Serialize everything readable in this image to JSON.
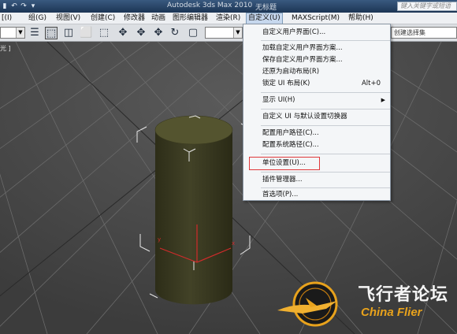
{
  "titlebar": {
    "quick_access": [
      "▮",
      "↶",
      "↷",
      "▾"
    ],
    "app_title": "Autodesk 3ds Max  2010",
    "doc_name": "无标题",
    "search_placeholder": "键入关键字或短语"
  },
  "menubar": {
    "items": [
      {
        "label": "[(I)"
      },
      {
        "label": "组(G)"
      },
      {
        "label": "视图(V)"
      },
      {
        "label": "创建(C)"
      },
      {
        "label": "修改器"
      },
      {
        "label": "动画"
      },
      {
        "label": "图形编辑器"
      },
      {
        "label": "渲染(R)"
      },
      {
        "label": "自定义(U)"
      },
      {
        "label": "MAXScript(M)"
      },
      {
        "label": "帮助(H)"
      }
    ]
  },
  "toolbar": {
    "selection_set_placeholder": "创建选择集",
    "icons": [
      "select-list-icon",
      "select-region-icon",
      "window-crossing-icon",
      "move-icon",
      "select-move-icon",
      "rotate-icon"
    ]
  },
  "viewport": {
    "label": "光 ]"
  },
  "dropdown": {
    "items": [
      {
        "label": "自定义用户界面(C)...",
        "shortcut": ""
      },
      {
        "label": "加载自定义用户界面方案...",
        "shortcut": ""
      },
      {
        "label": "保存自定义用户界面方案...",
        "shortcut": ""
      },
      {
        "label": "还原为启动布局(R)",
        "shortcut": ""
      },
      {
        "label": "锁定 UI 布局(K)",
        "shortcut": "Alt+0"
      },
      {
        "label": "显示 UI(H)",
        "shortcut": ""
      },
      {
        "label": "自定义 UI 与默认设置切换器",
        "shortcut": ""
      },
      {
        "label": "配置用户路径(C)...",
        "shortcut": ""
      },
      {
        "label": "配置系统路径(C)...",
        "shortcut": ""
      },
      {
        "label": "单位设置(U)...",
        "shortcut": ""
      },
      {
        "label": "插件管理器...",
        "shortcut": ""
      },
      {
        "label": "首选项(P)...",
        "shortcut": ""
      }
    ]
  },
  "watermark": {
    "cn": "飞行者论坛",
    "en": "China Flier"
  },
  "colors": {
    "titlebar": "#1c3554",
    "cylinder": "#3d3d22",
    "grid": "#6a6a6a",
    "highlight": "#e0383a",
    "watermark_orange": "#e8a21c"
  }
}
